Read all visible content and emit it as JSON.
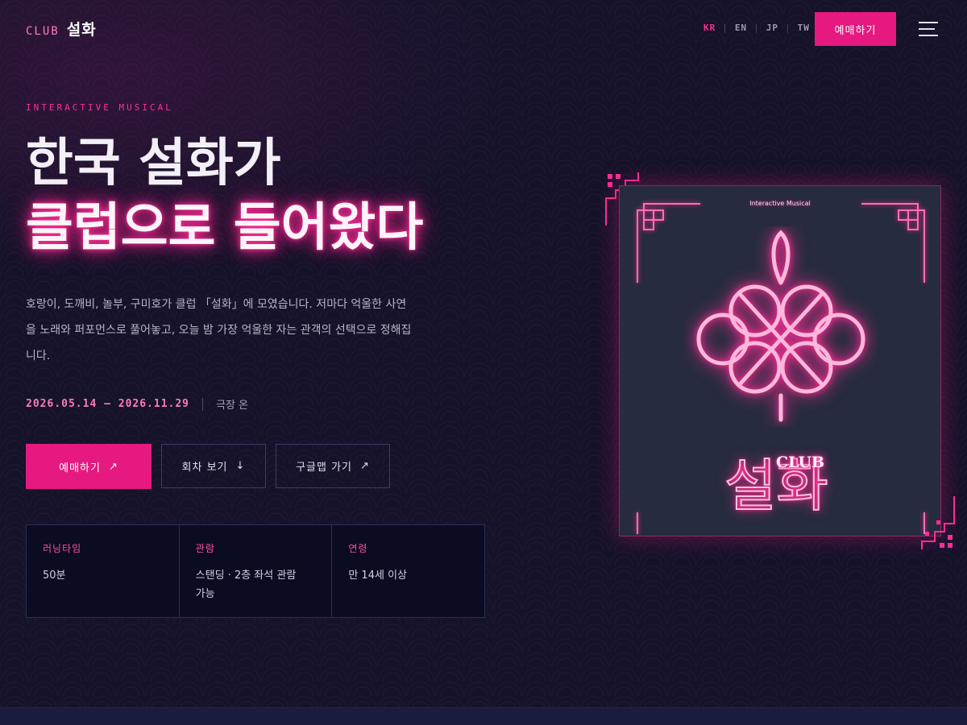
{
  "header": {
    "logo_prefix": "CLUB",
    "logo_name": "설화",
    "languages": [
      {
        "code": "KR",
        "active": true
      },
      {
        "code": "EN",
        "active": false
      },
      {
        "code": "JP",
        "active": false
      },
      {
        "code": "TW",
        "active": false
      }
    ],
    "cta_label": "예매하기",
    "menu_icon": "hamburger-menu-icon"
  },
  "hero": {
    "eyebrow": "INTERACTIVE MUSICAL",
    "title_line1": "한국 설화가",
    "title_line2": "클럽으로 들어왔다",
    "description": "호랑이, 도깨비, 놀부, 구미호가 클럽 「설화」에 모였습니다. 저마다 억울한 사연을 노래와 퍼포먼스로 풀어놓고, 오늘 밤 가장 억울한 자는 관객의 선택으로 정해집니다.",
    "date_range": "2026.05.14 — 2026.11.29",
    "venue": "극장 온"
  },
  "buttons": {
    "book_label": "예매하기",
    "book_icon": "arrow-up-right-icon",
    "schedule_label": "회차 보기",
    "schedule_icon": "arrow-down-icon",
    "map_label": "구글맵 가기",
    "map_icon": "arrow-up-right-icon"
  },
  "info": [
    {
      "label": "러닝타임",
      "value": "50분"
    },
    {
      "label": "관람",
      "value": "스탠딩 · 2층 좌석 관람 가능"
    },
    {
      "label": "연령",
      "value": "만 14세 이상"
    }
  ],
  "poster": {
    "label": "Interactive Musical",
    "club_text": "CLUB",
    "name_text": "설화",
    "motif_icon": "endless-knot-icon"
  },
  "colors": {
    "accent": "#e5197f",
    "neon": "#ff2d95",
    "background": "#15122a"
  }
}
